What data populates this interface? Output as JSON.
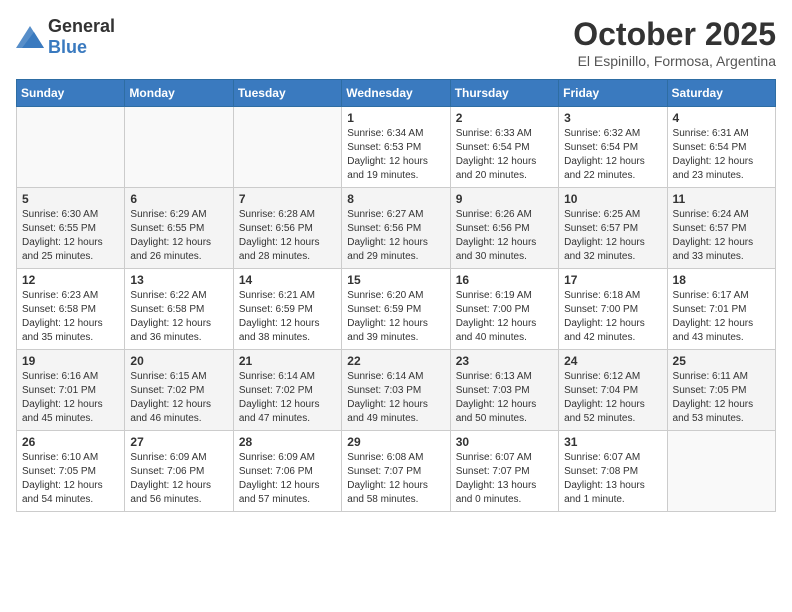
{
  "header": {
    "logo": {
      "general": "General",
      "blue": "Blue"
    },
    "title": "October 2025",
    "location": "El Espinillo, Formosa, Argentina"
  },
  "weekdays": [
    "Sunday",
    "Monday",
    "Tuesday",
    "Wednesday",
    "Thursday",
    "Friday",
    "Saturday"
  ],
  "weeks": [
    [
      {
        "day": "",
        "info": ""
      },
      {
        "day": "",
        "info": ""
      },
      {
        "day": "",
        "info": ""
      },
      {
        "day": "1",
        "info": "Sunrise: 6:34 AM\nSunset: 6:53 PM\nDaylight: 12 hours\nand 19 minutes."
      },
      {
        "day": "2",
        "info": "Sunrise: 6:33 AM\nSunset: 6:54 PM\nDaylight: 12 hours\nand 20 minutes."
      },
      {
        "day": "3",
        "info": "Sunrise: 6:32 AM\nSunset: 6:54 PM\nDaylight: 12 hours\nand 22 minutes."
      },
      {
        "day": "4",
        "info": "Sunrise: 6:31 AM\nSunset: 6:54 PM\nDaylight: 12 hours\nand 23 minutes."
      }
    ],
    [
      {
        "day": "5",
        "info": "Sunrise: 6:30 AM\nSunset: 6:55 PM\nDaylight: 12 hours\nand 25 minutes."
      },
      {
        "day": "6",
        "info": "Sunrise: 6:29 AM\nSunset: 6:55 PM\nDaylight: 12 hours\nand 26 minutes."
      },
      {
        "day": "7",
        "info": "Sunrise: 6:28 AM\nSunset: 6:56 PM\nDaylight: 12 hours\nand 28 minutes."
      },
      {
        "day": "8",
        "info": "Sunrise: 6:27 AM\nSunset: 6:56 PM\nDaylight: 12 hours\nand 29 minutes."
      },
      {
        "day": "9",
        "info": "Sunrise: 6:26 AM\nSunset: 6:56 PM\nDaylight: 12 hours\nand 30 minutes."
      },
      {
        "day": "10",
        "info": "Sunrise: 6:25 AM\nSunset: 6:57 PM\nDaylight: 12 hours\nand 32 minutes."
      },
      {
        "day": "11",
        "info": "Sunrise: 6:24 AM\nSunset: 6:57 PM\nDaylight: 12 hours\nand 33 minutes."
      }
    ],
    [
      {
        "day": "12",
        "info": "Sunrise: 6:23 AM\nSunset: 6:58 PM\nDaylight: 12 hours\nand 35 minutes."
      },
      {
        "day": "13",
        "info": "Sunrise: 6:22 AM\nSunset: 6:58 PM\nDaylight: 12 hours\nand 36 minutes."
      },
      {
        "day": "14",
        "info": "Sunrise: 6:21 AM\nSunset: 6:59 PM\nDaylight: 12 hours\nand 38 minutes."
      },
      {
        "day": "15",
        "info": "Sunrise: 6:20 AM\nSunset: 6:59 PM\nDaylight: 12 hours\nand 39 minutes."
      },
      {
        "day": "16",
        "info": "Sunrise: 6:19 AM\nSunset: 7:00 PM\nDaylight: 12 hours\nand 40 minutes."
      },
      {
        "day": "17",
        "info": "Sunrise: 6:18 AM\nSunset: 7:00 PM\nDaylight: 12 hours\nand 42 minutes."
      },
      {
        "day": "18",
        "info": "Sunrise: 6:17 AM\nSunset: 7:01 PM\nDaylight: 12 hours\nand 43 minutes."
      }
    ],
    [
      {
        "day": "19",
        "info": "Sunrise: 6:16 AM\nSunset: 7:01 PM\nDaylight: 12 hours\nand 45 minutes."
      },
      {
        "day": "20",
        "info": "Sunrise: 6:15 AM\nSunset: 7:02 PM\nDaylight: 12 hours\nand 46 minutes."
      },
      {
        "day": "21",
        "info": "Sunrise: 6:14 AM\nSunset: 7:02 PM\nDaylight: 12 hours\nand 47 minutes."
      },
      {
        "day": "22",
        "info": "Sunrise: 6:14 AM\nSunset: 7:03 PM\nDaylight: 12 hours\nand 49 minutes."
      },
      {
        "day": "23",
        "info": "Sunrise: 6:13 AM\nSunset: 7:03 PM\nDaylight: 12 hours\nand 50 minutes."
      },
      {
        "day": "24",
        "info": "Sunrise: 6:12 AM\nSunset: 7:04 PM\nDaylight: 12 hours\nand 52 minutes."
      },
      {
        "day": "25",
        "info": "Sunrise: 6:11 AM\nSunset: 7:05 PM\nDaylight: 12 hours\nand 53 minutes."
      }
    ],
    [
      {
        "day": "26",
        "info": "Sunrise: 6:10 AM\nSunset: 7:05 PM\nDaylight: 12 hours\nand 54 minutes."
      },
      {
        "day": "27",
        "info": "Sunrise: 6:09 AM\nSunset: 7:06 PM\nDaylight: 12 hours\nand 56 minutes."
      },
      {
        "day": "28",
        "info": "Sunrise: 6:09 AM\nSunset: 7:06 PM\nDaylight: 12 hours\nand 57 minutes."
      },
      {
        "day": "29",
        "info": "Sunrise: 6:08 AM\nSunset: 7:07 PM\nDaylight: 12 hours\nand 58 minutes."
      },
      {
        "day": "30",
        "info": "Sunrise: 6:07 AM\nSunset: 7:07 PM\nDaylight: 13 hours\nand 0 minutes."
      },
      {
        "day": "31",
        "info": "Sunrise: 6:07 AM\nSunset: 7:08 PM\nDaylight: 13 hours\nand 1 minute."
      },
      {
        "day": "",
        "info": ""
      }
    ]
  ]
}
